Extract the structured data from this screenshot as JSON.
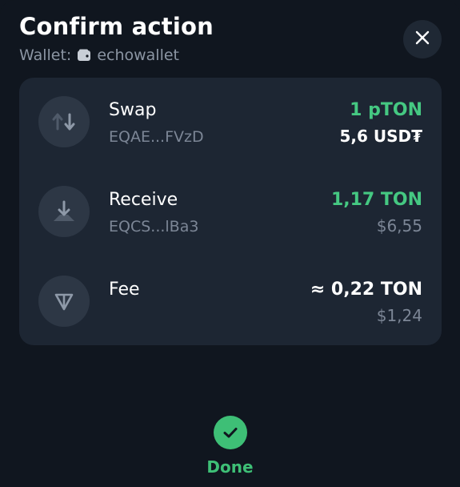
{
  "header": {
    "title": "Confirm action",
    "wallet_prefix": "Wallet:",
    "wallet_name": "echowallet"
  },
  "actions": [
    {
      "title": "Swap",
      "address": "EQAE...FVzD",
      "primary": "1 pTON",
      "secondary": "5,6 USD₮",
      "icon": "swap-arrows-icon"
    },
    {
      "title": "Receive",
      "address": "EQCS...lBa3",
      "primary": "1,17 TON",
      "secondary": "$6,55",
      "icon": "receive-arrow-icon"
    },
    {
      "title": "Fee",
      "primary": "≈ 0,22 TON",
      "secondary": "$1,24",
      "icon": "ton-icon"
    }
  ],
  "footer": {
    "done_label": "Done",
    "done_icon": "checkmark-icon"
  },
  "colors": {
    "accent_green": "#45c882",
    "background": "#10161f",
    "card": "#1d2633"
  }
}
